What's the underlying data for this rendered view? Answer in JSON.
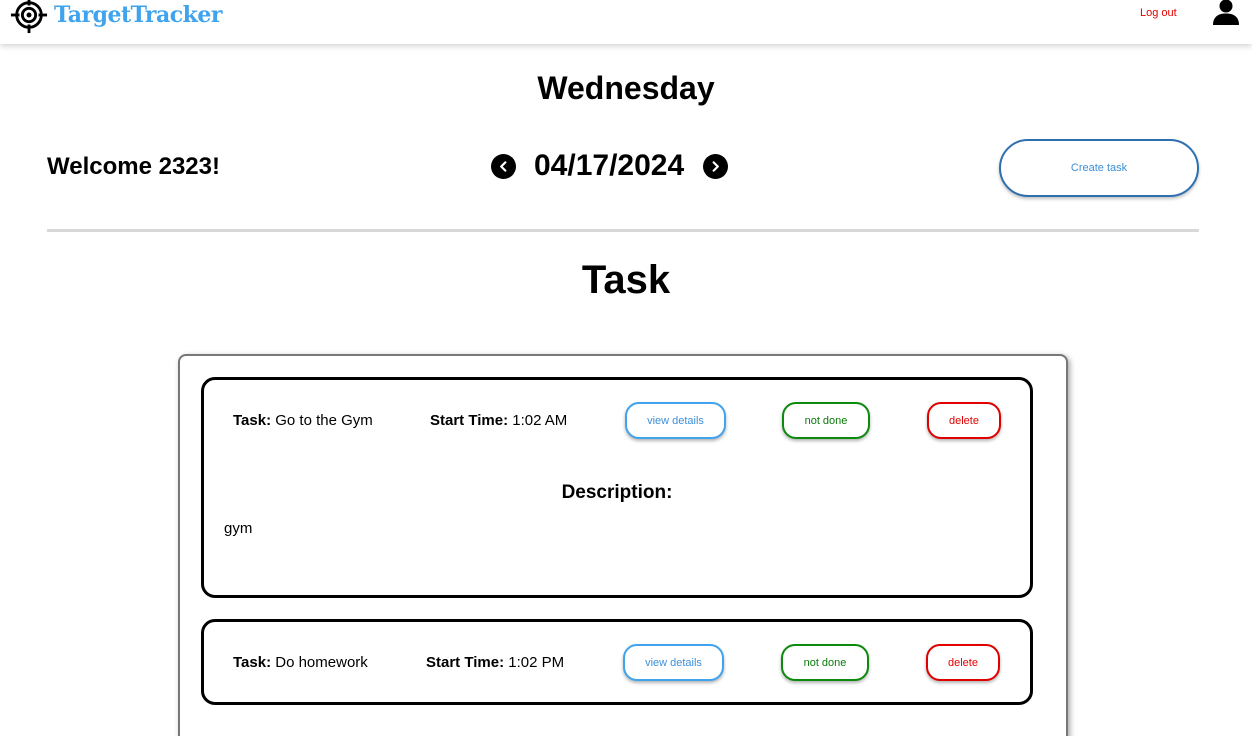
{
  "header": {
    "brand": "TargetTracker",
    "brand_color": "#3fa3ee",
    "logo_icon": "target-icon",
    "logout_label": "Log out",
    "user_icon": "user-icon"
  },
  "dashboard": {
    "day": "Wednesday",
    "welcome": "Welcome 2323!",
    "date": "04/17/2024",
    "prev_icon": "chevron-left-icon",
    "next_icon": "chevron-right-icon",
    "create_task_label": "Create task",
    "section_title": "Task"
  },
  "tasks": [
    {
      "task_label": "Task:",
      "task_name": "Go to the Gym",
      "start_label": "Start Time:",
      "start_time": "1:02 AM",
      "view_label": "view details",
      "status_label": "not done",
      "delete_label": "delete",
      "description_heading": "Description:",
      "description": "gym"
    },
    {
      "task_label": "Task:",
      "task_name": "Do homework",
      "start_label": "Start Time:",
      "start_time": "1:02 PM",
      "view_label": "view details",
      "status_label": "not done",
      "delete_label": "delete"
    }
  ],
  "colors": {
    "view": "#3fa3ee",
    "done": "#0b8a0b",
    "delete": "#e00000",
    "create_border": "#2e6fb0"
  }
}
